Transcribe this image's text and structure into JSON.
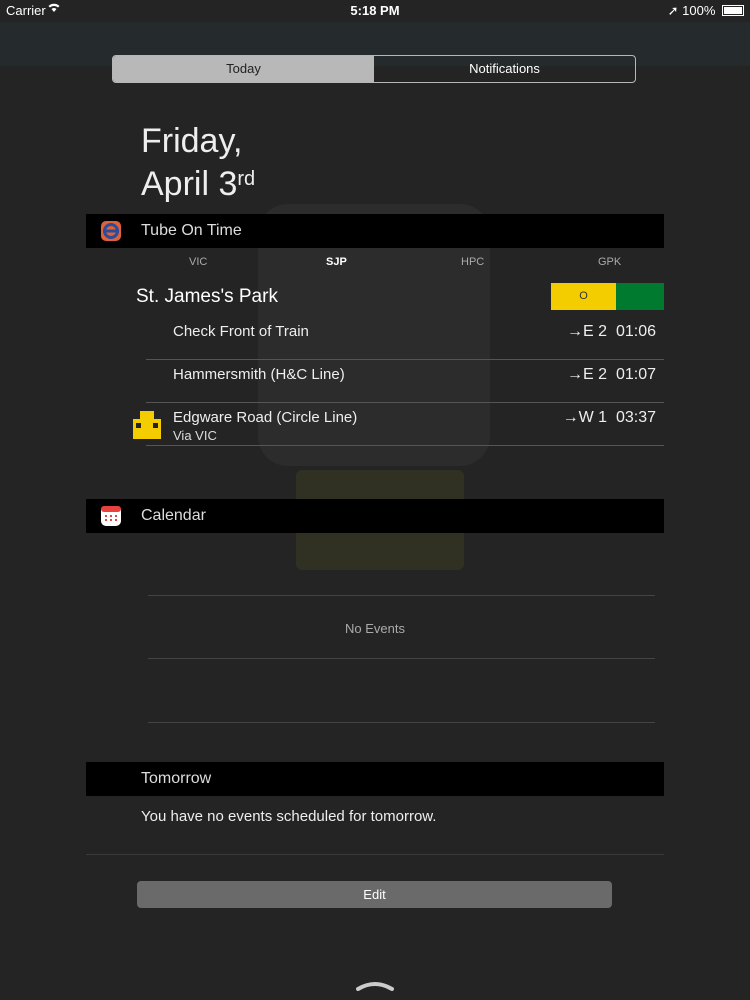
{
  "status_bar": {
    "carrier": "Carrier",
    "time": "5:18 PM",
    "battery": "100%"
  },
  "tabs": [
    {
      "label": "Today",
      "selected": true
    },
    {
      "label": "Notifications",
      "selected": false
    }
  ],
  "date": {
    "line1": "Friday,",
    "line2": "April 3",
    "suffix": "rd"
  },
  "tube_widget": {
    "title": "Tube On Time",
    "stations": [
      {
        "code": "VIC",
        "current": false
      },
      {
        "code": "SJP",
        "current": true
      },
      {
        "code": "HPC",
        "current": false
      },
      {
        "code": "GPK",
        "current": false
      }
    ],
    "station_name": "St. James's Park",
    "line_status_label": "O",
    "colors": {
      "circle_line": "#f4cd00",
      "district_line": "#007a2f"
    },
    "departures": [
      {
        "destination": "Check Front of Train",
        "via": "",
        "direction": "→E 2",
        "time": "01:06"
      },
      {
        "destination": "Hammersmith (H&C Line)",
        "via": "",
        "direction": "→E 2",
        "time": "01:07"
      },
      {
        "destination": "Edgware Road (Circle Line)",
        "via": "Via VIC",
        "direction": "→W 1",
        "time": "03:37"
      }
    ]
  },
  "calendar_widget": {
    "title": "Calendar",
    "no_events": "No Events"
  },
  "tomorrow": {
    "title": "Tomorrow",
    "text": "You have no events scheduled for tomorrow."
  },
  "edit_button": "Edit"
}
